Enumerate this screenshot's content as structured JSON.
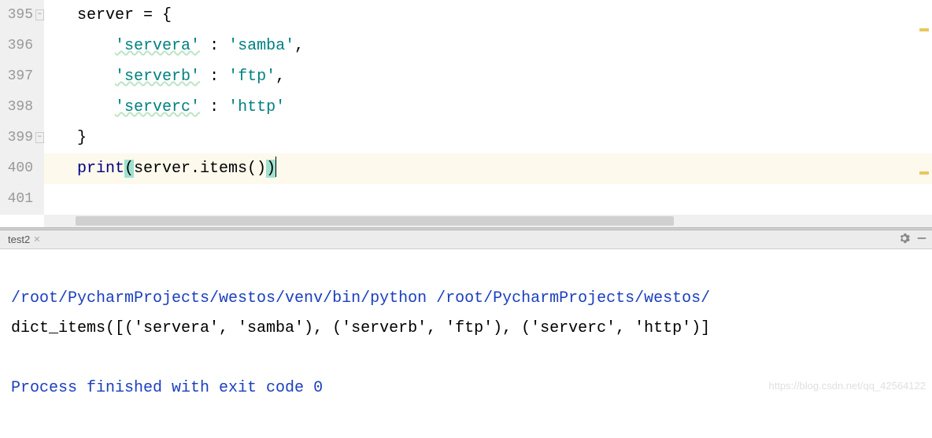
{
  "editor": {
    "lines": [
      {
        "num": "395",
        "raw": "server = {"
      },
      {
        "num": "396",
        "raw": "    'servera' : 'samba',"
      },
      {
        "num": "397",
        "raw": "    'serverb' : 'ftp',"
      },
      {
        "num": "398",
        "raw": "    'serverc' : 'http'"
      },
      {
        "num": "399",
        "raw": "}"
      },
      {
        "num": "400",
        "raw": "print(server.items())"
      },
      {
        "num": "401",
        "raw": ""
      }
    ],
    "current_line_index": 5
  },
  "tool_window": {
    "tab_name": "test2"
  },
  "console": {
    "command_line": "/root/PycharmProjects/westos/venv/bin/python /root/PycharmProjects/westos/",
    "output_line": "dict_items([('servera', 'samba'), ('serverb', 'ftp'), ('serverc', 'http')]",
    "exit_line": "Process finished with exit code 0"
  },
  "watermark": "https://blog.csdn.net/qq_42564122"
}
